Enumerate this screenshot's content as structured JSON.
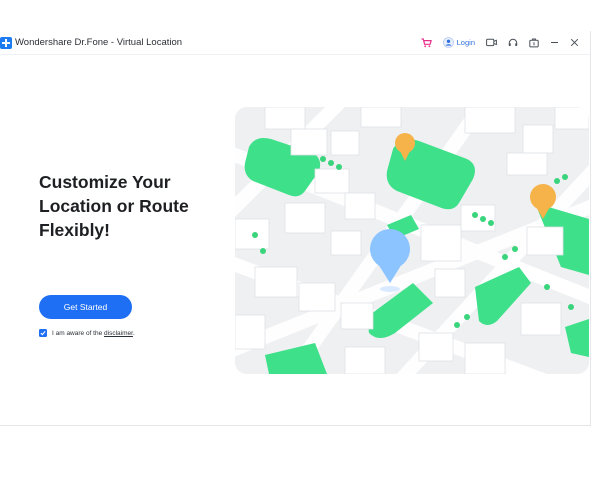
{
  "window": {
    "title": "Wondershare Dr.Fone - Virtual Location",
    "logo_icon": "drfone-plus-icon",
    "actions": [
      {
        "name": "cart-icon",
        "color": "#e8308a"
      },
      {
        "name": "user-avatar-icon",
        "label": "Login",
        "color": "#2f6fde"
      },
      {
        "name": "feedback-icon"
      },
      {
        "name": "headset-icon"
      },
      {
        "name": "toolbox-icon"
      },
      {
        "name": "minimize-icon"
      },
      {
        "name": "close-icon"
      }
    ]
  },
  "hero": {
    "headline_lines": [
      "Customize Your",
      "Location or Route",
      "Flexibly!"
    ],
    "cta_label": "Get Started",
    "agree_prefix": "I am aware of the ",
    "agree_link": "disclaimer",
    "agree_suffix": ".",
    "agree_checked": true
  },
  "colors": {
    "accent": "#1e6ff4",
    "park_green": "#3ee08a",
    "pin_orange": "#f5b34a",
    "pin_blue": "#8cc4ff"
  }
}
